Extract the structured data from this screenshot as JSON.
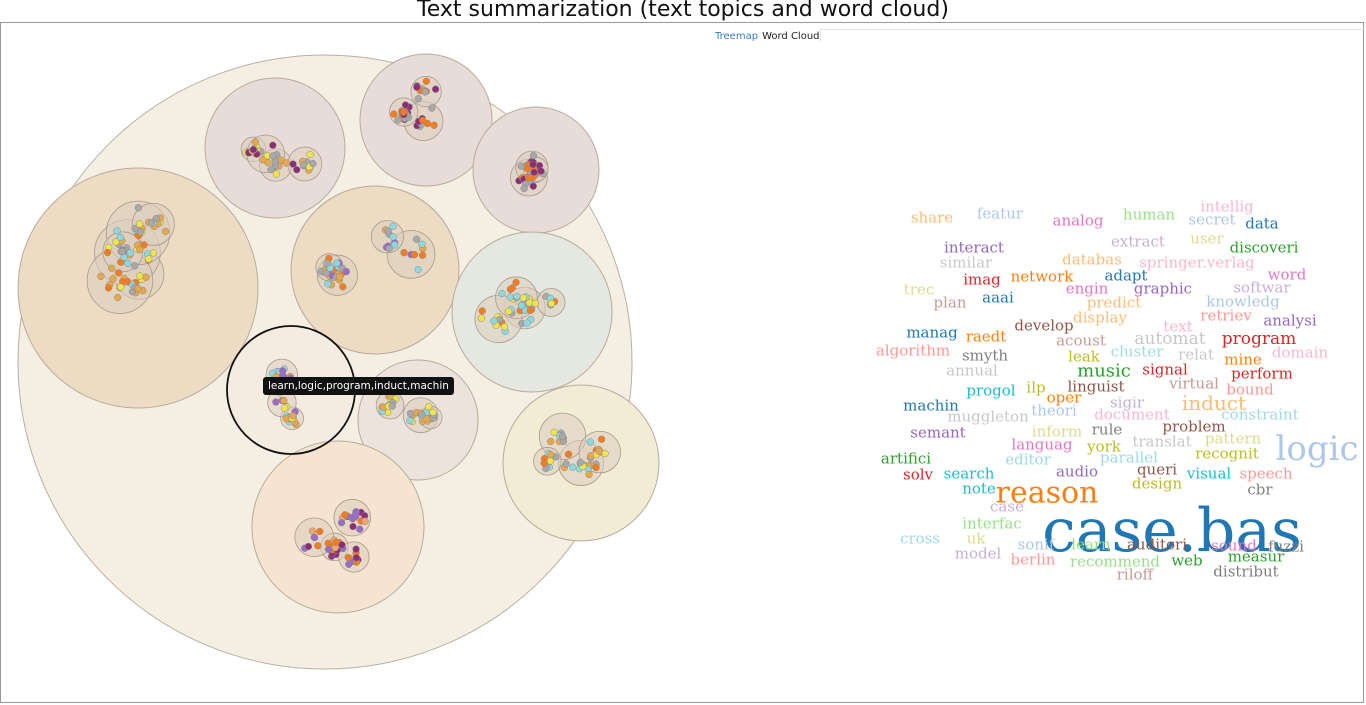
{
  "page": {
    "title": "Text summarization (text topics and word cloud)",
    "tabs": [
      {
        "label": "Treemap",
        "active": false
      },
      {
        "label": "Word Cloud",
        "active": true
      }
    ],
    "tooltip": "learn,logic,program,induct,machin"
  },
  "colors": {
    "outer_fill": "#f5efe3",
    "dot_palette": [
      "#f47c20",
      "#8e2c76",
      "#a8a8a8",
      "#f1e34a",
      "#8dd8e0",
      "#e8a84a",
      "#9a6cc8",
      "#f3a46a",
      "#d6d68a",
      "#c9a36a"
    ]
  },
  "word_cloud": [
    {
      "text": "intellig",
      "color": "#f7b6d2"
    },
    {
      "text": "share",
      "color": "#ffbb78"
    },
    {
      "text": "featur",
      "color": "#aec7e8"
    },
    {
      "text": "human",
      "color": "#98df8a"
    },
    {
      "text": "secret",
      "color": "#aec7e8"
    },
    {
      "text": "data",
      "color": "#1f77b4"
    },
    {
      "text": "analog",
      "color": "#e377c2"
    },
    {
      "text": "interact",
      "color": "#9467bd"
    },
    {
      "text": "extract",
      "color": "#c5b0d5"
    },
    {
      "text": "user",
      "color": "#dbdb8d"
    },
    {
      "text": "discoveri",
      "color": "#2ca02c"
    },
    {
      "text": "similar",
      "color": "#c7c7c7"
    },
    {
      "text": "databas",
      "color": "#ffbb78"
    },
    {
      "text": "springer.verlag",
      "color": "#f7b6d2"
    },
    {
      "text": "imag",
      "color": "#d62728"
    },
    {
      "text": "network",
      "color": "#ff7f0e"
    },
    {
      "text": "adapt",
      "color": "#1f77b4"
    },
    {
      "text": "word",
      "color": "#e377c2"
    },
    {
      "text": "trec",
      "color": "#dbdb8d"
    },
    {
      "text": "engin",
      "color": "#e377c2"
    },
    {
      "text": "graphic",
      "color": "#9467bd"
    },
    {
      "text": "softwar",
      "color": "#c5b0d5"
    },
    {
      "text": "plan",
      "color": "#c49c94"
    },
    {
      "text": "aaai",
      "color": "#1f77b4"
    },
    {
      "text": "predict",
      "color": "#ffbb78"
    },
    {
      "text": "knowledg",
      "color": "#aec7e8"
    },
    {
      "text": "display",
      "color": "#ffbb78"
    },
    {
      "text": "retriev",
      "color": "#ff9896"
    },
    {
      "text": "analysi",
      "color": "#9467bd"
    },
    {
      "text": "develop",
      "color": "#8c564b"
    },
    {
      "text": "text",
      "color": "#f7b6d2"
    },
    {
      "text": "manag",
      "color": "#1f77b4"
    },
    {
      "text": "raedt",
      "color": "#ff7f0e"
    },
    {
      "text": "acoust",
      "color": "#c49c94"
    },
    {
      "text": "automat",
      "color": "#c7c7c7"
    },
    {
      "text": "program",
      "color": "#d62728"
    },
    {
      "text": "algorithm",
      "color": "#ff9896"
    },
    {
      "text": "smyth",
      "color": "#7f7f7f"
    },
    {
      "text": "leak",
      "color": "#bcbd22"
    },
    {
      "text": "cluster",
      "color": "#9edae5"
    },
    {
      "text": "relat",
      "color": "#c7c7c7"
    },
    {
      "text": "mine",
      "color": "#ff7f0e"
    },
    {
      "text": "domain",
      "color": "#f7b6d2"
    },
    {
      "text": "annual",
      "color": "#c7c7c7"
    },
    {
      "text": "music",
      "color": "#2ca02c"
    },
    {
      "text": "signal",
      "color": "#d62728"
    },
    {
      "text": "perform",
      "color": "#d62728"
    },
    {
      "text": "progol",
      "color": "#17becf"
    },
    {
      "text": "ilp",
      "color": "#bcbd22"
    },
    {
      "text": "linguist",
      "color": "#8c564b"
    },
    {
      "text": "virtual",
      "color": "#c49c94"
    },
    {
      "text": "bound",
      "color": "#ff9896"
    },
    {
      "text": "oper",
      "color": "#ff7f0e"
    },
    {
      "text": "induct",
      "color": "#ffbb78"
    },
    {
      "text": "machin",
      "color": "#1f77b4"
    },
    {
      "text": "sigir",
      "color": "#c5b0d5"
    },
    {
      "text": "muggleton",
      "color": "#c7c7c7"
    },
    {
      "text": "theori",
      "color": "#aec7e8"
    },
    {
      "text": "document",
      "color": "#f7b6d2"
    },
    {
      "text": "constraint",
      "color": "#9edae5"
    },
    {
      "text": "problem",
      "color": "#8c564b"
    },
    {
      "text": "semant",
      "color": "#9467bd"
    },
    {
      "text": "inform",
      "color": "#dbdb8d"
    },
    {
      "text": "rule",
      "color": "#7f7f7f"
    },
    {
      "text": "pattern",
      "color": "#dbdb8d"
    },
    {
      "text": "logic",
      "color": "#aec7e8"
    },
    {
      "text": "languag",
      "color": "#e377c2"
    },
    {
      "text": "york",
      "color": "#bcbd22"
    },
    {
      "text": "translat",
      "color": "#c7c7c7"
    },
    {
      "text": "recognit",
      "color": "#bcbd22"
    },
    {
      "text": "artifici",
      "color": "#2ca02c"
    },
    {
      "text": "editor",
      "color": "#9edae5"
    },
    {
      "text": "parallel",
      "color": "#9edae5"
    },
    {
      "text": "solv",
      "color": "#d62728"
    },
    {
      "text": "search",
      "color": "#17becf"
    },
    {
      "text": "audio",
      "color": "#9467bd"
    },
    {
      "text": "queri",
      "color": "#8c564b"
    },
    {
      "text": "visual",
      "color": "#17becf"
    },
    {
      "text": "speech",
      "color": "#ff9896"
    },
    {
      "text": "reason",
      "color": "#ff7f0e"
    },
    {
      "text": "note",
      "color": "#17becf"
    },
    {
      "text": "design",
      "color": "#bcbd22"
    },
    {
      "text": "cbr",
      "color": "#7f7f7f"
    },
    {
      "text": "case",
      "color": "#c5b0d5"
    },
    {
      "text": "case.bas",
      "color": "#1f77b4"
    },
    {
      "text": "interfac",
      "color": "#98df8a"
    },
    {
      "text": "cross",
      "color": "#9edae5"
    },
    {
      "text": "uk",
      "color": "#dbdb8d"
    },
    {
      "text": "sonif",
      "color": "#aec7e8"
    },
    {
      "text": "learn",
      "color": "#98df8a"
    },
    {
      "text": "auditori",
      "color": "#8c564b"
    },
    {
      "text": "sound",
      "color": "#e377c2"
    },
    {
      "text": "fuzzi",
      "color": "#7f7f7f"
    },
    {
      "text": "model",
      "color": "#c5b0d5"
    },
    {
      "text": "berlin",
      "color": "#ff9896"
    },
    {
      "text": "recommend",
      "color": "#98df8a"
    },
    {
      "text": "web",
      "color": "#2ca02c"
    },
    {
      "text": "measur",
      "color": "#2ca02c"
    },
    {
      "text": "riloff",
      "color": "#c49c94"
    },
    {
      "text": "distribut",
      "color": "#7f7f7f"
    }
  ]
}
